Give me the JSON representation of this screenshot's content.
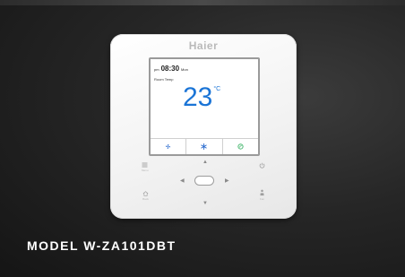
{
  "product": {
    "brand": "Haier",
    "model_label": "MODEL W-ZA101DBT"
  },
  "screen": {
    "ampm": "pm",
    "time": "08:30",
    "day": "Mon",
    "room_label": "Room Temp",
    "temperature": "23",
    "unit": "°C",
    "modes": [
      {
        "icon": "fan-mode-icon",
        "color": "#2f6fd0"
      },
      {
        "icon": "cool-mode-icon",
        "color": "#2f6fd0"
      },
      {
        "icon": "eco-mode-icon",
        "color": "#2fae5c"
      }
    ]
  },
  "keys": {
    "menu_label": "Menu",
    "power_label": "",
    "back_label": "Back",
    "fan_label": "Fan"
  },
  "colors": {
    "temperature": "#1a74d6",
    "background": "#1f1f1f",
    "device": "#f5f5f5"
  }
}
